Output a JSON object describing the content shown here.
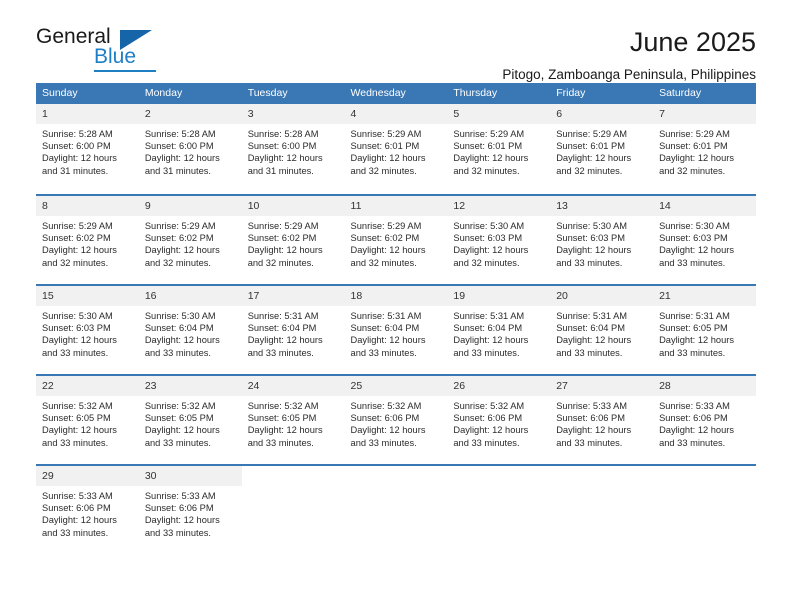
{
  "logo": {
    "word_general": "General",
    "word_blue": "Blue",
    "triangle_color": "#1565a8",
    "blue_color": "#1f7fc4"
  },
  "header": {
    "title": "June 2025",
    "subtitle": "Pitogo, Zamboanga Peninsula, Philippines"
  },
  "theme": {
    "header_bg": "#3a78b5",
    "daynum_bg": "#f1f1f1",
    "text": "#2b2b2b"
  },
  "weekday_headers": [
    "Sunday",
    "Monday",
    "Tuesday",
    "Wednesday",
    "Thursday",
    "Friday",
    "Saturday"
  ],
  "weeks": [
    [
      {
        "day": "1",
        "sunrise": "Sunrise: 5:28 AM",
        "sunset": "Sunset: 6:00 PM",
        "daylight1": "Daylight: 12 hours",
        "daylight2": "and 31 minutes."
      },
      {
        "day": "2",
        "sunrise": "Sunrise: 5:28 AM",
        "sunset": "Sunset: 6:00 PM",
        "daylight1": "Daylight: 12 hours",
        "daylight2": "and 31 minutes."
      },
      {
        "day": "3",
        "sunrise": "Sunrise: 5:28 AM",
        "sunset": "Sunset: 6:00 PM",
        "daylight1": "Daylight: 12 hours",
        "daylight2": "and 31 minutes."
      },
      {
        "day": "4",
        "sunrise": "Sunrise: 5:29 AM",
        "sunset": "Sunset: 6:01 PM",
        "daylight1": "Daylight: 12 hours",
        "daylight2": "and 32 minutes."
      },
      {
        "day": "5",
        "sunrise": "Sunrise: 5:29 AM",
        "sunset": "Sunset: 6:01 PM",
        "daylight1": "Daylight: 12 hours",
        "daylight2": "and 32 minutes."
      },
      {
        "day": "6",
        "sunrise": "Sunrise: 5:29 AM",
        "sunset": "Sunset: 6:01 PM",
        "daylight1": "Daylight: 12 hours",
        "daylight2": "and 32 minutes."
      },
      {
        "day": "7",
        "sunrise": "Sunrise: 5:29 AM",
        "sunset": "Sunset: 6:01 PM",
        "daylight1": "Daylight: 12 hours",
        "daylight2": "and 32 minutes."
      }
    ],
    [
      {
        "day": "8",
        "sunrise": "Sunrise: 5:29 AM",
        "sunset": "Sunset: 6:02 PM",
        "daylight1": "Daylight: 12 hours",
        "daylight2": "and 32 minutes."
      },
      {
        "day": "9",
        "sunrise": "Sunrise: 5:29 AM",
        "sunset": "Sunset: 6:02 PM",
        "daylight1": "Daylight: 12 hours",
        "daylight2": "and 32 minutes."
      },
      {
        "day": "10",
        "sunrise": "Sunrise: 5:29 AM",
        "sunset": "Sunset: 6:02 PM",
        "daylight1": "Daylight: 12 hours",
        "daylight2": "and 32 minutes."
      },
      {
        "day": "11",
        "sunrise": "Sunrise: 5:29 AM",
        "sunset": "Sunset: 6:02 PM",
        "daylight1": "Daylight: 12 hours",
        "daylight2": "and 32 minutes."
      },
      {
        "day": "12",
        "sunrise": "Sunrise: 5:30 AM",
        "sunset": "Sunset: 6:03 PM",
        "daylight1": "Daylight: 12 hours",
        "daylight2": "and 32 minutes."
      },
      {
        "day": "13",
        "sunrise": "Sunrise: 5:30 AM",
        "sunset": "Sunset: 6:03 PM",
        "daylight1": "Daylight: 12 hours",
        "daylight2": "and 33 minutes."
      },
      {
        "day": "14",
        "sunrise": "Sunrise: 5:30 AM",
        "sunset": "Sunset: 6:03 PM",
        "daylight1": "Daylight: 12 hours",
        "daylight2": "and 33 minutes."
      }
    ],
    [
      {
        "day": "15",
        "sunrise": "Sunrise: 5:30 AM",
        "sunset": "Sunset: 6:03 PM",
        "daylight1": "Daylight: 12 hours",
        "daylight2": "and 33 minutes."
      },
      {
        "day": "16",
        "sunrise": "Sunrise: 5:30 AM",
        "sunset": "Sunset: 6:04 PM",
        "daylight1": "Daylight: 12 hours",
        "daylight2": "and 33 minutes."
      },
      {
        "day": "17",
        "sunrise": "Sunrise: 5:31 AM",
        "sunset": "Sunset: 6:04 PM",
        "daylight1": "Daylight: 12 hours",
        "daylight2": "and 33 minutes."
      },
      {
        "day": "18",
        "sunrise": "Sunrise: 5:31 AM",
        "sunset": "Sunset: 6:04 PM",
        "daylight1": "Daylight: 12 hours",
        "daylight2": "and 33 minutes."
      },
      {
        "day": "19",
        "sunrise": "Sunrise: 5:31 AM",
        "sunset": "Sunset: 6:04 PM",
        "daylight1": "Daylight: 12 hours",
        "daylight2": "and 33 minutes."
      },
      {
        "day": "20",
        "sunrise": "Sunrise: 5:31 AM",
        "sunset": "Sunset: 6:04 PM",
        "daylight1": "Daylight: 12 hours",
        "daylight2": "and 33 minutes."
      },
      {
        "day": "21",
        "sunrise": "Sunrise: 5:31 AM",
        "sunset": "Sunset: 6:05 PM",
        "daylight1": "Daylight: 12 hours",
        "daylight2": "and 33 minutes."
      }
    ],
    [
      {
        "day": "22",
        "sunrise": "Sunrise: 5:32 AM",
        "sunset": "Sunset: 6:05 PM",
        "daylight1": "Daylight: 12 hours",
        "daylight2": "and 33 minutes."
      },
      {
        "day": "23",
        "sunrise": "Sunrise: 5:32 AM",
        "sunset": "Sunset: 6:05 PM",
        "daylight1": "Daylight: 12 hours",
        "daylight2": "and 33 minutes."
      },
      {
        "day": "24",
        "sunrise": "Sunrise: 5:32 AM",
        "sunset": "Sunset: 6:05 PM",
        "daylight1": "Daylight: 12 hours",
        "daylight2": "and 33 minutes."
      },
      {
        "day": "25",
        "sunrise": "Sunrise: 5:32 AM",
        "sunset": "Sunset: 6:06 PM",
        "daylight1": "Daylight: 12 hours",
        "daylight2": "and 33 minutes."
      },
      {
        "day": "26",
        "sunrise": "Sunrise: 5:32 AM",
        "sunset": "Sunset: 6:06 PM",
        "daylight1": "Daylight: 12 hours",
        "daylight2": "and 33 minutes."
      },
      {
        "day": "27",
        "sunrise": "Sunrise: 5:33 AM",
        "sunset": "Sunset: 6:06 PM",
        "daylight1": "Daylight: 12 hours",
        "daylight2": "and 33 minutes."
      },
      {
        "day": "28",
        "sunrise": "Sunrise: 5:33 AM",
        "sunset": "Sunset: 6:06 PM",
        "daylight1": "Daylight: 12 hours",
        "daylight2": "and 33 minutes."
      }
    ],
    [
      {
        "day": "29",
        "sunrise": "Sunrise: 5:33 AM",
        "sunset": "Sunset: 6:06 PM",
        "daylight1": "Daylight: 12 hours",
        "daylight2": "and 33 minutes."
      },
      {
        "day": "30",
        "sunrise": "Sunrise: 5:33 AM",
        "sunset": "Sunset: 6:06 PM",
        "daylight1": "Daylight: 12 hours",
        "daylight2": "and 33 minutes."
      },
      {
        "day": "",
        "sunrise": "",
        "sunset": "",
        "daylight1": "",
        "daylight2": ""
      },
      {
        "day": "",
        "sunrise": "",
        "sunset": "",
        "daylight1": "",
        "daylight2": ""
      },
      {
        "day": "",
        "sunrise": "",
        "sunset": "",
        "daylight1": "",
        "daylight2": ""
      },
      {
        "day": "",
        "sunrise": "",
        "sunset": "",
        "daylight1": "",
        "daylight2": ""
      },
      {
        "day": "",
        "sunrise": "",
        "sunset": "",
        "daylight1": "",
        "daylight2": ""
      }
    ]
  ]
}
